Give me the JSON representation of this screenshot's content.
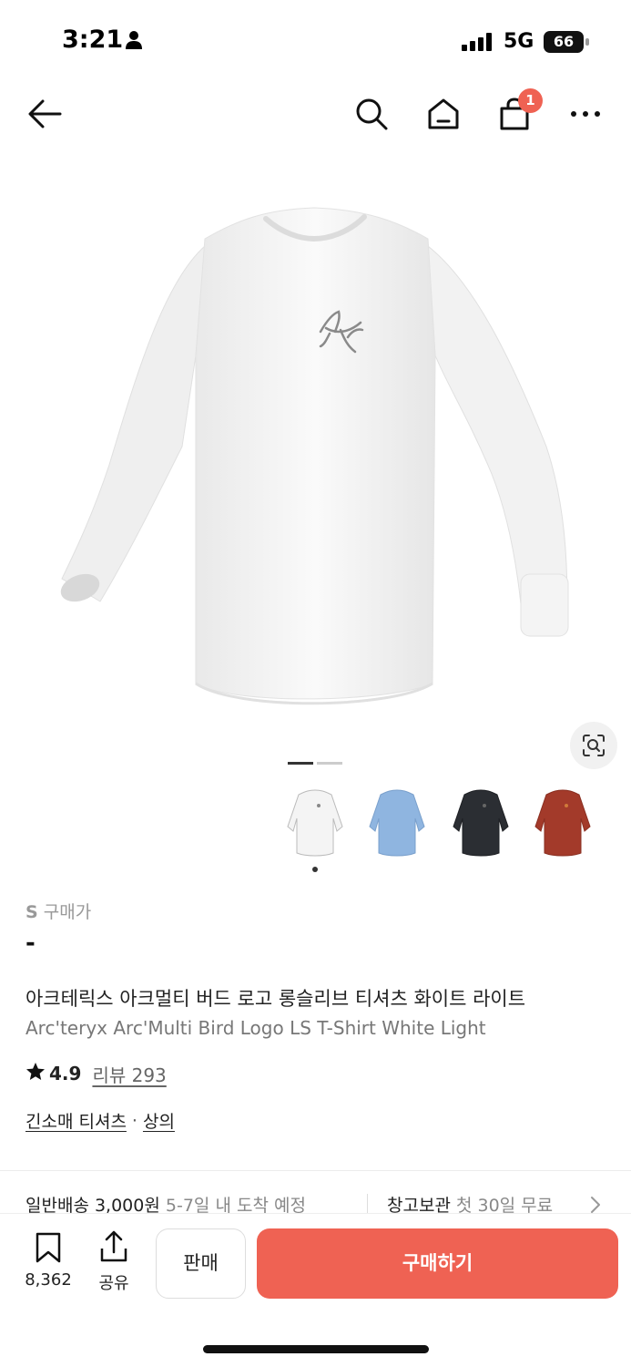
{
  "status_bar": {
    "time": "3:21",
    "network": "5G",
    "battery": "66"
  },
  "nav": {
    "back_icon": "arrow-left-icon",
    "search_icon": "search-icon",
    "home_icon": "home-icon",
    "cart_icon": "shopping-bag-icon",
    "cart_badge": "1",
    "more_icon": "more-horizontal-icon"
  },
  "gallery": {
    "current_page": 1,
    "page_count": 2,
    "lens_icon": "image-search-icon"
  },
  "color_options": [
    {
      "name": "White Light",
      "color": "#f4f4f4",
      "selected": true
    },
    {
      "name": "Light Blue",
      "color": "#8fb5e0",
      "selected": false
    },
    {
      "name": "Black",
      "color": "#2b2e33",
      "selected": false
    },
    {
      "name": "Red",
      "color": "#a33a2a",
      "selected": false
    }
  ],
  "product": {
    "size_code": "S",
    "size_label": "구매가",
    "price": "-",
    "title_ko": "아크테릭스 아크멀티 버드 로고 롱슬리브 티셔츠 화이트 라이트",
    "title_en": "Arc'teryx Arc'Multi Bird Logo LS T-Shirt White Light",
    "rating": "4.9",
    "review_text": "리뷰 293",
    "category_1": "긴소매 티셔츠",
    "category_sep": "·",
    "category_2": "상의"
  },
  "shipping": {
    "label": "일반배송 3,000원",
    "eta": "5-7일 내 도착 예정",
    "storage_label": "창고보관",
    "storage_detail": "첫 30일 무료"
  },
  "bottom_bar": {
    "bookmark_count": "8,362",
    "share_label": "공유",
    "sell_label": "판매",
    "buy_label": "구매하기"
  },
  "colors": {
    "accent": "#ef6253",
    "text": "#222222",
    "muted": "#888888"
  }
}
